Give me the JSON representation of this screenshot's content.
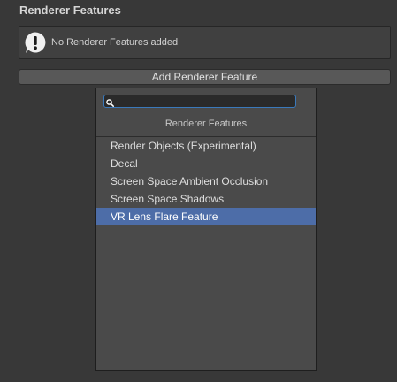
{
  "section": {
    "title": "Renderer Features"
  },
  "helpbox": {
    "icon": "warning-exclamation-icon",
    "message": "No Renderer Features added"
  },
  "add_button": {
    "label": "Add Renderer Feature"
  },
  "popup": {
    "search": {
      "value": "",
      "placeholder": "",
      "icon": "search-icon"
    },
    "header": "Renderer Features",
    "items": [
      {
        "label": "Render Objects (Experimental)",
        "selected": false
      },
      {
        "label": "Decal",
        "selected": false
      },
      {
        "label": "Screen Space Ambient Occlusion",
        "selected": false
      },
      {
        "label": "Screen Space Shadows",
        "selected": false
      },
      {
        "label": "VR Lens Flare Feature",
        "selected": true
      }
    ]
  },
  "colors": {
    "background": "#383838",
    "selection": "#4d6da8",
    "search_focus_border": "#3a79bb"
  }
}
